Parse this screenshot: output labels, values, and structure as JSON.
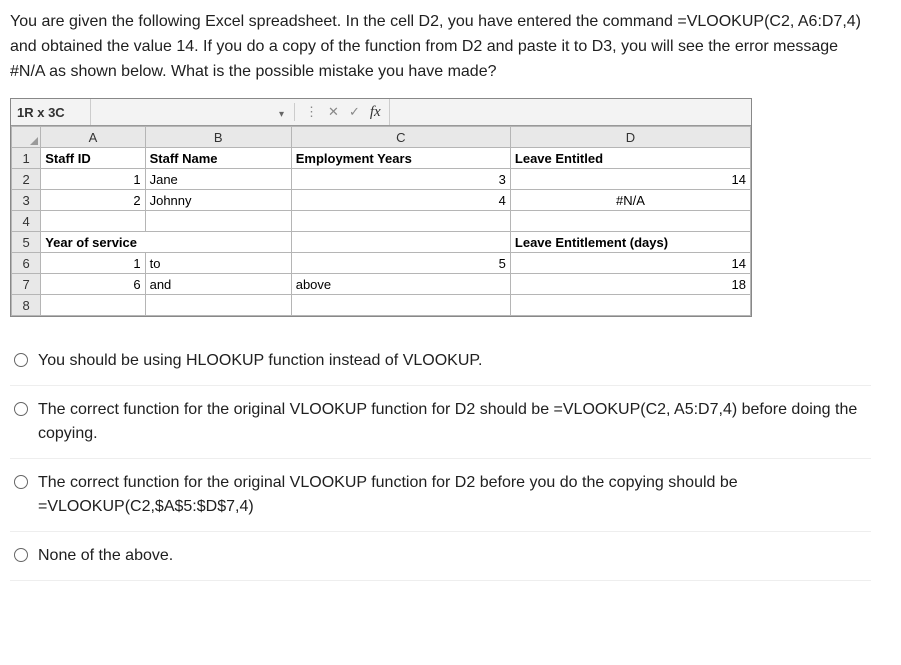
{
  "question": {
    "prompt": "You are given the following Excel spreadsheet. In the cell D2, you have entered the command =VLOOKUP(C2, A6:D7,4) and obtained the value  14. If you do a copy of the function from D2 and paste it to D3, you will see the error message #N/A as shown below. What is the possible mistake you have made?"
  },
  "excel": {
    "namebox": "1R x 3C",
    "fx_label": "fx",
    "columns": {
      "A": "A",
      "B": "B",
      "C": "C",
      "D": "D"
    },
    "rows": {
      "r1": {
        "A": "Staff ID",
        "B": "Staff Name",
        "C": "Employment Years",
        "D": "Leave Entitled"
      },
      "r2": {
        "A": "1",
        "B": "Jane",
        "C": "3",
        "D": "14"
      },
      "r3": {
        "A": "2",
        "B": "Johnny",
        "C": "4",
        "D": "#N/A"
      },
      "r4": {
        "A": "",
        "B": "",
        "C": "",
        "D": ""
      },
      "r5": {
        "A": "Year of service",
        "B": "",
        "C": "",
        "D": "Leave Entitlement (days)"
      },
      "r6": {
        "A": "1",
        "B": "to",
        "C": "5",
        "D": "14"
      },
      "r7": {
        "A": "6",
        "B": "and",
        "C": "above",
        "D": "18"
      },
      "r8": {
        "A": "",
        "B": "",
        "C": "",
        "D": ""
      }
    },
    "rowlabels": {
      "r1": "1",
      "r2": "2",
      "r3": "3",
      "r4": "4",
      "r5": "5",
      "r6": "6",
      "r7": "7",
      "r8": "8"
    }
  },
  "options": {
    "a": "You should be using HLOOKUP function instead of VLOOKUP.",
    "b": "The correct function for the original VLOOKUP function for D2 should be =VLOOKUP(C2, A5:D7,4) before doing the copying.",
    "c": "The correct function for the original VLOOKUP function for D2 before you do the copying should be =VLOOKUP(C2,$A$5:$D$7,4)",
    "d": "None of the above."
  }
}
